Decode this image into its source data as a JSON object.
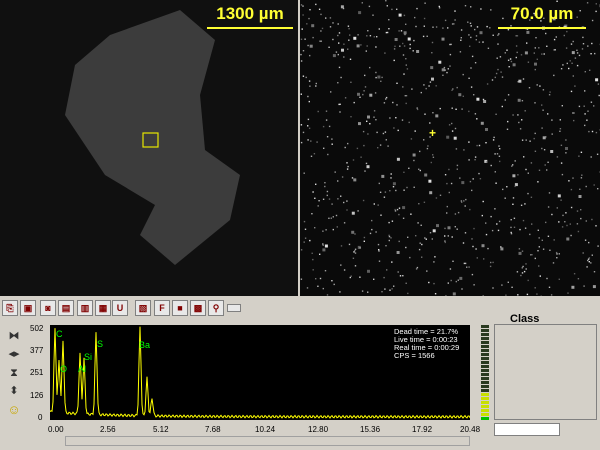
{
  "left_image": {
    "scale_label": "1300 µm"
  },
  "right_image": {
    "scale_label": "70.0 µm"
  },
  "toolbar": {
    "icons": [
      "paste-icon",
      "save-icon",
      "camera-icon",
      "print-preview-icon",
      "print-icon",
      "label-icon",
      "marker-icon",
      "report-icon",
      "f-icon",
      "stop-icon",
      "grid-icon",
      "probe-icon",
      "blank-icon"
    ],
    "f_label": "F",
    "u_label": "U"
  },
  "spectrum": {
    "stats": {
      "dead_time": "Dead time = 21.7%",
      "live_time": "Live time = 0:00:23",
      "real_time": "Real time = 0:00:29",
      "cps": "CPS = 1566"
    },
    "y_ticks": [
      "502",
      "377",
      "251",
      "126",
      "0"
    ],
    "x_ticks": [
      "0.00",
      "2.56",
      "5.12",
      "7.68",
      "10.24",
      "12.80",
      "15.36",
      "17.92",
      "20.48"
    ],
    "peak_labels": [
      "C",
      "O",
      "Al",
      "Si",
      "S",
      "Ba"
    ],
    "trace_color": "#ffff00",
    "label_color": "#00ff00"
  },
  "class_panel": {
    "title": "Class"
  }
}
